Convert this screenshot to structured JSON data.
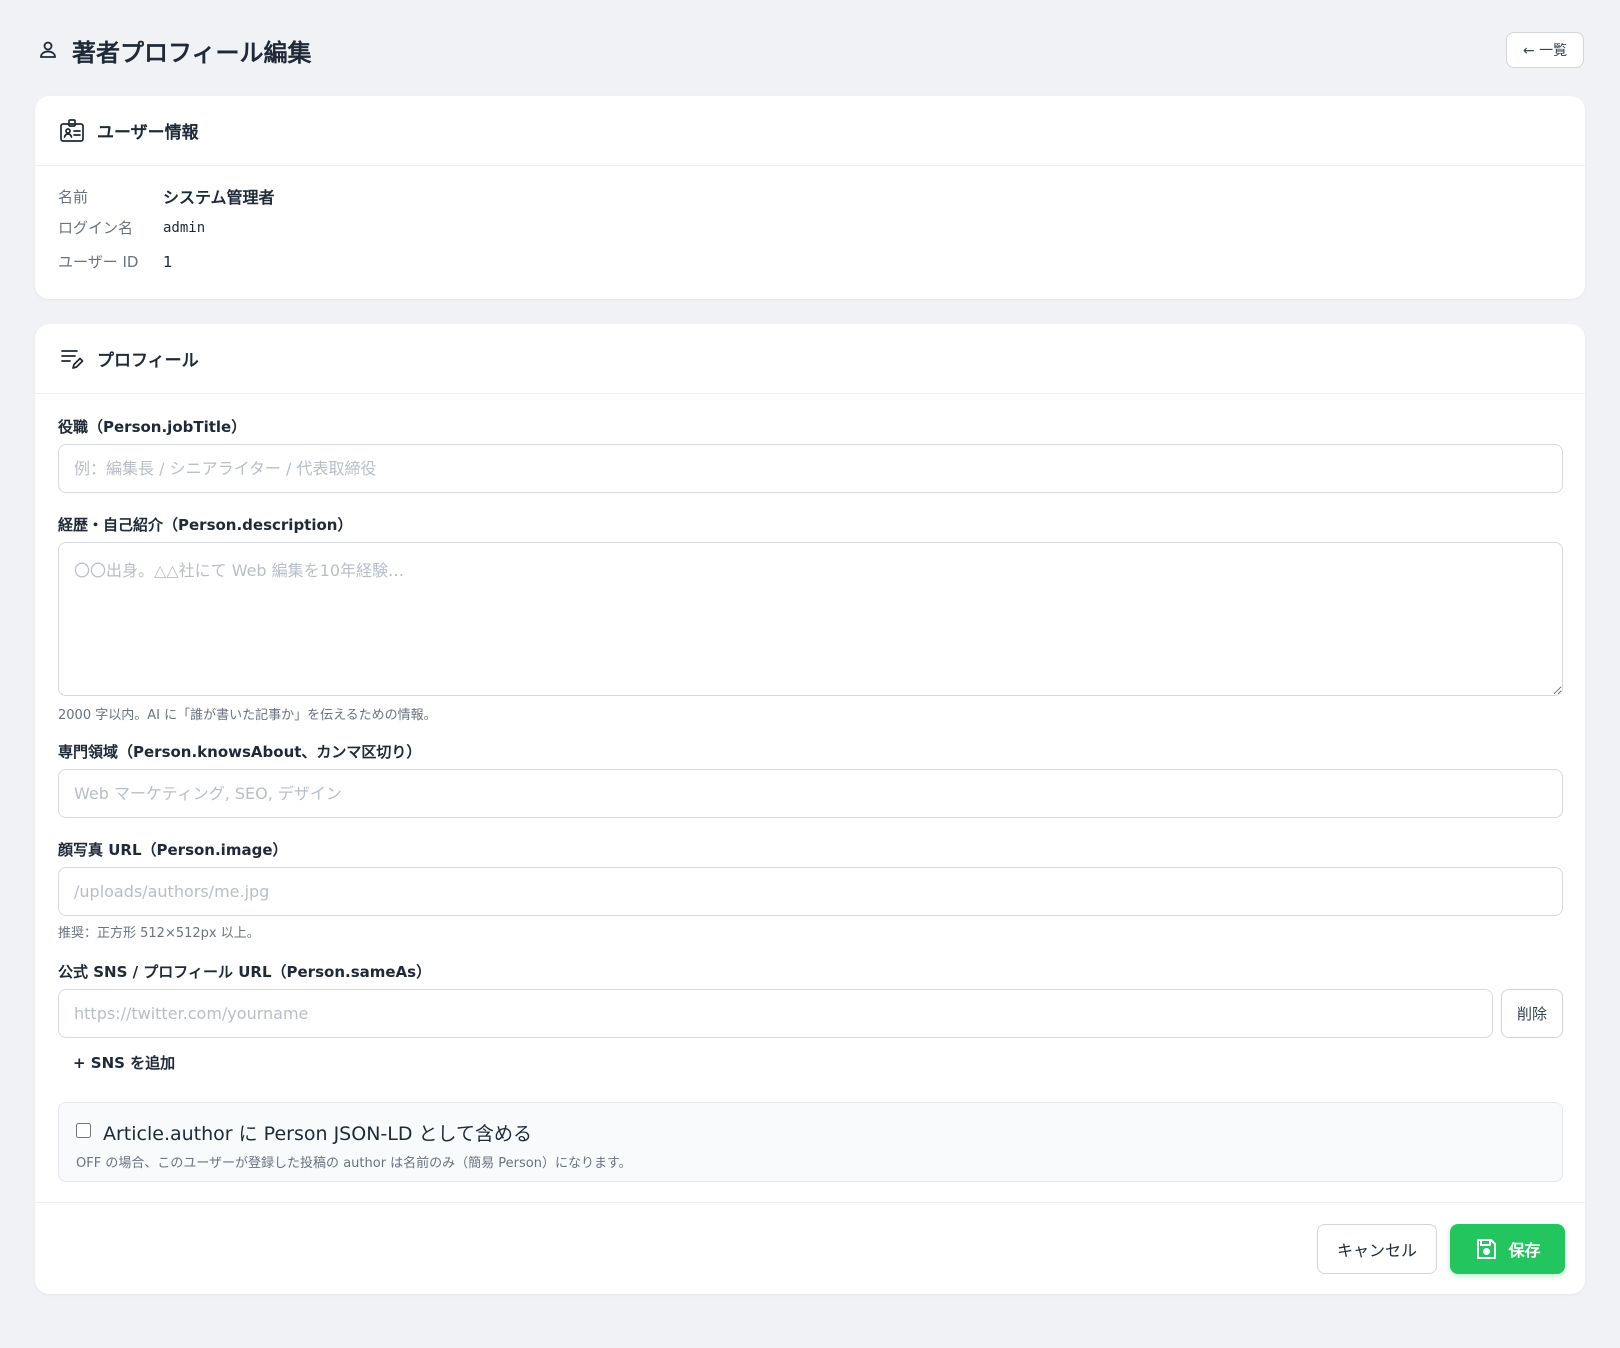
{
  "header": {
    "title": "著者プロフィール編集",
    "back_label": "← 一覧"
  },
  "user_info": {
    "title": "ユーザー情報",
    "rows": [
      {
        "label": "名前",
        "value": "システム管理者"
      },
      {
        "label": "ログイン名",
        "value": "admin"
      },
      {
        "label": "ユーザー ID",
        "value": "1"
      }
    ]
  },
  "profile": {
    "title": "プロフィール",
    "job_title": {
      "label": "役職（Person.jobTitle）",
      "placeholder": "例：編集長 / シニアライター / 代表取締役",
      "value": ""
    },
    "description": {
      "label": "経歴・自己紹介（Person.description）",
      "placeholder": "〇〇出身。△△社にて Web 編集を10年経験…",
      "value": "",
      "help": "2000 字以内。AI に「誰が書いた記事か」を伝えるための情報。"
    },
    "knows_about": {
      "label": "専門領域（Person.knowsAbout、カンマ区切り）",
      "placeholder": "Web マーケティング, SEO, デザイン",
      "value": ""
    },
    "image": {
      "label": "顔写真 URL（Person.image）",
      "placeholder": "/uploads/authors/me.jpg",
      "value": "",
      "help": "推奨：正方形 512×512px 以上。"
    },
    "same_as": {
      "label": "公式 SNS / プロフィール URL（Person.sameAs）",
      "placeholder": "https://twitter.com/yourname",
      "value": "",
      "delete_label": "削除",
      "add_label": "+ SNS を追加"
    },
    "jsonld": {
      "checked": false,
      "title": "Article.author に Person JSON-LD として含める",
      "help": "OFF の場合、このユーザーが登録した投稿の author は名前のみ（簡易 Person）になります。"
    }
  },
  "footer": {
    "cancel_label": "キャンセル",
    "save_label": "保存"
  },
  "colors": {
    "background": "#f0f2f5",
    "card": "#ffffff",
    "save_button": "#22c55e",
    "placeholder": "#b8bec8"
  },
  "icons": [
    "user-icon",
    "id-badge-icon",
    "edit-list-icon",
    "save-disk-icon"
  ]
}
